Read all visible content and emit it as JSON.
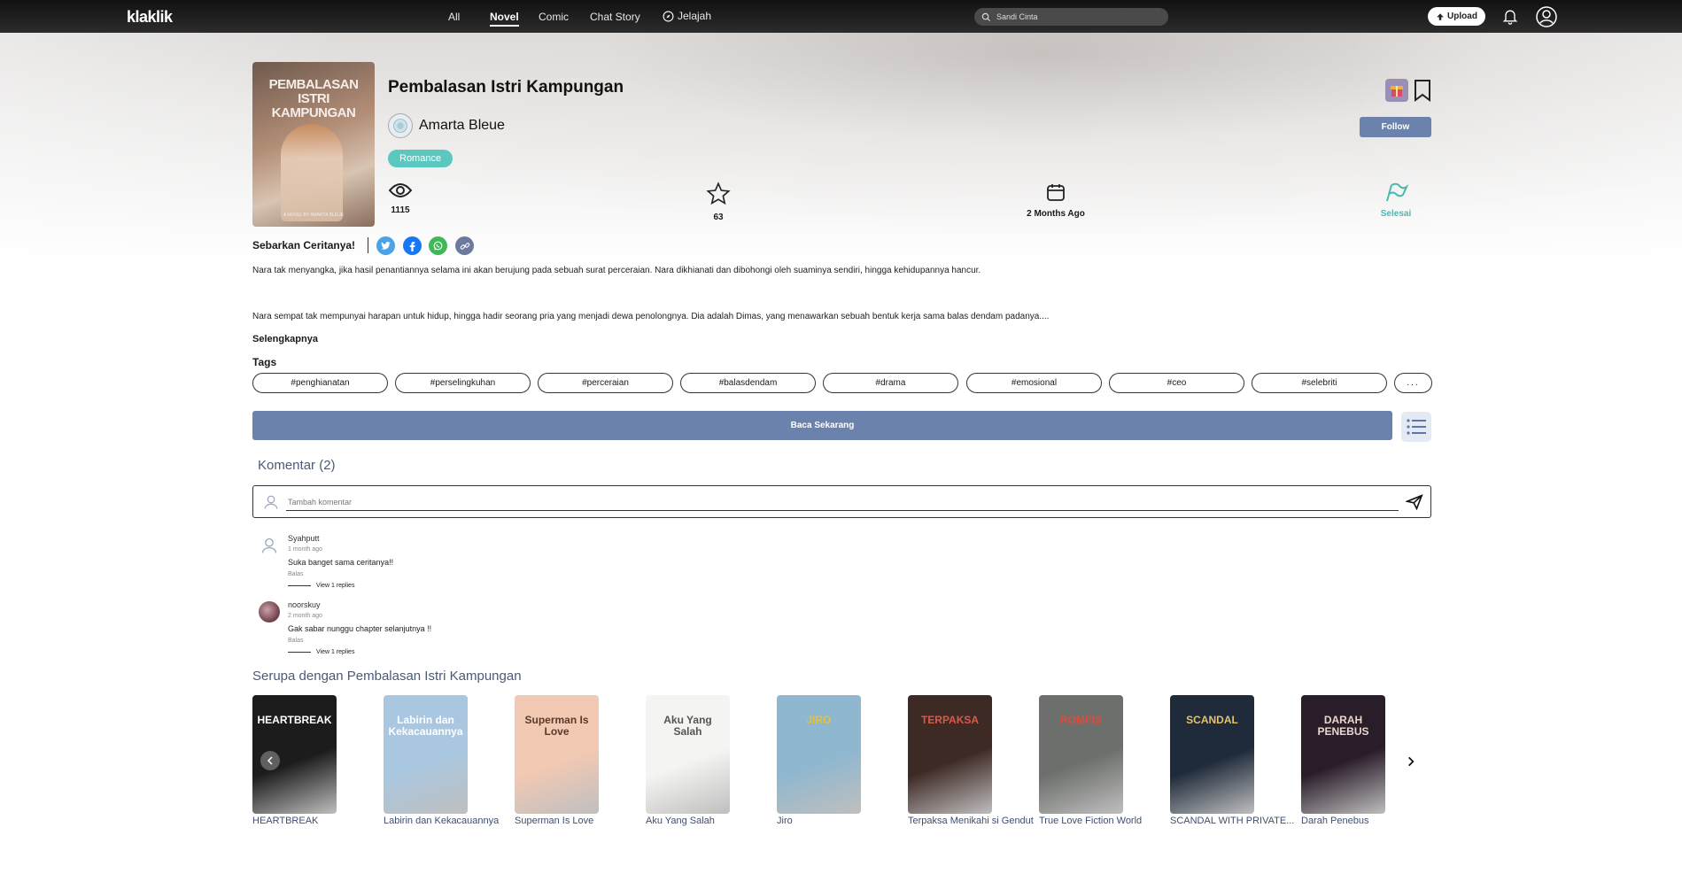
{
  "header": {
    "logo": "klaklik",
    "nav": [
      "All",
      "Novel",
      "Comic",
      "Chat Story",
      "Jelajah"
    ],
    "active_nav": "Novel",
    "search_placeholder": "Sandi Cinta",
    "upload_label": "Upload"
  },
  "book": {
    "title": "Pembalasan Istri Kampungan",
    "cover_title": "PEMBALASAN ISTRI KAMPUNGAN",
    "cover_subtitle": "A NOVEL BY AMARTA BLEUE",
    "author": "Amarta Bleue",
    "genre": "Romance",
    "follow_label": "Follow",
    "stats": {
      "views": "1115",
      "rating": "63",
      "updated": "2 Months Ago",
      "status": "Selesai"
    },
    "share_label": "Sebarkan Ceritanya!",
    "synopsis": [
      "Nara tak menyangka, jika hasil penantiannya selama ini akan berujung pada sebuah surat perceraian. Nara dikhianati dan dibohongi oleh suaminya sendiri, hingga kehidupannya hancur.",
      "Nara sempat tak mempunyai harapan untuk hidup, hingga hadir seorang pria yang menjadi dewa penolongnya. Dia adalah Dimas, yang menawarkan sebuah bentuk kerja sama balas dendam padanya...."
    ],
    "more_label": "Selengkapnya",
    "tags_label": "Tags",
    "tags": [
      "#penghianatan",
      "#perselingkuhan",
      "#perceraian",
      "#balasdendam",
      "#drama",
      "#emosional",
      "#ceo",
      "#selebriti"
    ],
    "tags_more": "...",
    "read_label": "Baca Sekarang"
  },
  "comments": {
    "title": "Komentar (2)",
    "placeholder": "Tambah komentar",
    "items": [
      {
        "user": "Syahputt",
        "time": "1 month ago",
        "text": "Suka banget sama ceritanya!!",
        "reply": "Balas",
        "view": "View 1 replies"
      },
      {
        "user": "noorskuy",
        "time": "2 month ago",
        "text": "Gak sabar nunggu chapter selanjutnya !!",
        "reply": "Balas",
        "view": "View 1 replies"
      }
    ]
  },
  "similar": {
    "title": "Serupa dengan Pembalasan Istri Kampungan",
    "items": [
      {
        "label": "HEARTBREAK",
        "cover_text": "HEARTBREAK",
        "bg": "#1c1c1c",
        "fg": "#ffffff"
      },
      {
        "label": "Labirin dan Kekacauannya",
        "cover_text": "Labirin dan Kekacauannya",
        "bg": "#a9c7e0",
        "fg": "#ffffff"
      },
      {
        "label": "Superman Is Love",
        "cover_text": "Superman Is Love",
        "bg": "#f2c9b3",
        "fg": "#5a3a2a"
      },
      {
        "label": "Aku Yang Salah",
        "cover_text": "Aku Yang Salah",
        "bg": "#f4f4f2",
        "fg": "#555555"
      },
      {
        "label": "Jiro",
        "cover_text": "JIRO",
        "bg": "#8fb7cf",
        "fg": "#e4c23a"
      },
      {
        "label": "Terpaksa Menikahi si Gendut",
        "cover_text": "TERPAKSA",
        "bg": "#3e2a25",
        "fg": "#d65a4a"
      },
      {
        "label": "True Love Fiction World",
        "cover_text": "ROMPIS",
        "bg": "#6c6f6b",
        "fg": "#e04a3a"
      },
      {
        "label": "SCANDAL WITH PRIVATE...",
        "cover_text": "SCANDAL",
        "bg": "#1f2a3a",
        "fg": "#e2c36b"
      },
      {
        "label": "Darah Penebus",
        "cover_text": "DARAH PENEBUS",
        "bg": "#2a1d2a",
        "fg": "#e9d6cc"
      }
    ]
  }
}
